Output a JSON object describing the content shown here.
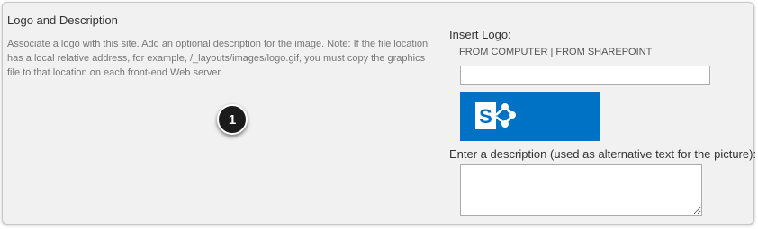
{
  "section": {
    "title": "Logo and Description",
    "description": "Associate a logo with this site. Add an optional description for the image. Note: If the file location has a local relative address, for example, /_layouts/images/logo.gif, you must copy the graphics file to that location on each front-end Web server."
  },
  "step_badge": {
    "number": "1"
  },
  "insert_logo": {
    "label": "Insert Logo:",
    "from_computer": "FROM COMPUTER",
    "separator": "|",
    "from_sharepoint": "FROM SHAREPOINT",
    "url_value": "",
    "logo_icon": "sharepoint-logo"
  },
  "alt_text": {
    "label": "Enter a description (used as alternative text for the picture):",
    "value": ""
  },
  "colors": {
    "panel_background": "#f1f1f1",
    "logo_background": "#0072c6",
    "badge_background": "#1b1b1b"
  }
}
